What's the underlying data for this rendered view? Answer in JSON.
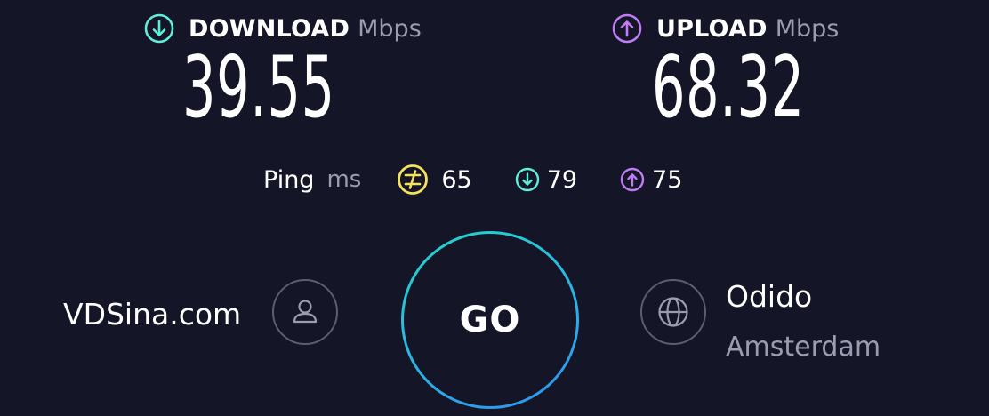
{
  "download": {
    "label": "DOWNLOAD",
    "unit": "Mbps",
    "value": "39.55",
    "icon": "arrow-down-circle-icon",
    "color": "#5eeedb"
  },
  "upload": {
    "label": "UPLOAD",
    "unit": "Mbps",
    "value": "68.32",
    "icon": "arrow-up-circle-icon",
    "color": "#c07cf5"
  },
  "ping": {
    "label": "Ping",
    "unit": "ms",
    "idle": {
      "value": "65",
      "icon": "ping-idle-icon",
      "color": "#f3e25f"
    },
    "download": {
      "value": "79",
      "icon": "arrow-down-circle-icon",
      "color": "#5eeedb"
    },
    "upload": {
      "value": "75",
      "icon": "arrow-up-circle-icon",
      "color": "#c07cf5"
    }
  },
  "host": {
    "name": "VDSina.com",
    "icon": "user-icon"
  },
  "go": {
    "label": "GO"
  },
  "isp": {
    "name": "Odido",
    "location": "Amsterdam",
    "icon": "globe-icon"
  }
}
